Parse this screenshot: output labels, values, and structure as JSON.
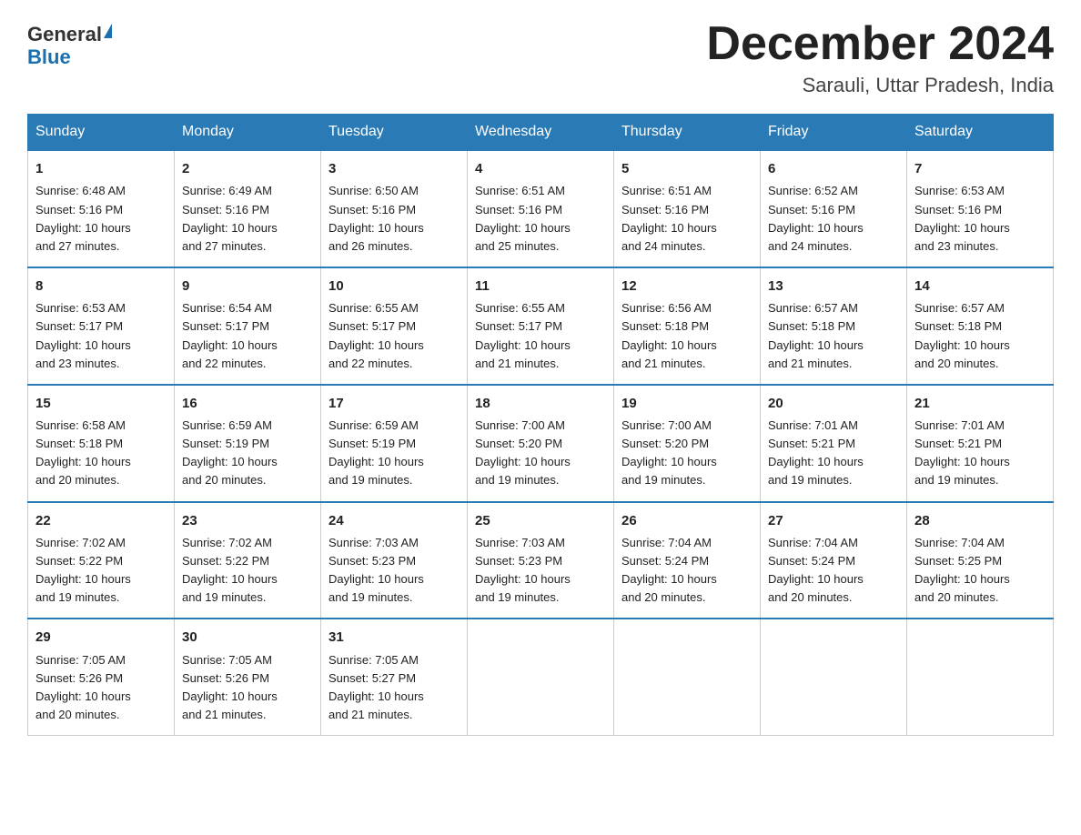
{
  "header": {
    "logo_general": "General",
    "logo_blue": "Blue",
    "month_title": "December 2024",
    "location": "Sarauli, Uttar Pradesh, India"
  },
  "days_of_week": [
    "Sunday",
    "Monday",
    "Tuesday",
    "Wednesday",
    "Thursday",
    "Friday",
    "Saturday"
  ],
  "weeks": [
    [
      {
        "day": "1",
        "sunrise": "6:48 AM",
        "sunset": "5:16 PM",
        "daylight": "10 hours and 27 minutes."
      },
      {
        "day": "2",
        "sunrise": "6:49 AM",
        "sunset": "5:16 PM",
        "daylight": "10 hours and 27 minutes."
      },
      {
        "day": "3",
        "sunrise": "6:50 AM",
        "sunset": "5:16 PM",
        "daylight": "10 hours and 26 minutes."
      },
      {
        "day": "4",
        "sunrise": "6:51 AM",
        "sunset": "5:16 PM",
        "daylight": "10 hours and 25 minutes."
      },
      {
        "day": "5",
        "sunrise": "6:51 AM",
        "sunset": "5:16 PM",
        "daylight": "10 hours and 24 minutes."
      },
      {
        "day": "6",
        "sunrise": "6:52 AM",
        "sunset": "5:16 PM",
        "daylight": "10 hours and 24 minutes."
      },
      {
        "day": "7",
        "sunrise": "6:53 AM",
        "sunset": "5:16 PM",
        "daylight": "10 hours and 23 minutes."
      }
    ],
    [
      {
        "day": "8",
        "sunrise": "6:53 AM",
        "sunset": "5:17 PM",
        "daylight": "10 hours and 23 minutes."
      },
      {
        "day": "9",
        "sunrise": "6:54 AM",
        "sunset": "5:17 PM",
        "daylight": "10 hours and 22 minutes."
      },
      {
        "day": "10",
        "sunrise": "6:55 AM",
        "sunset": "5:17 PM",
        "daylight": "10 hours and 22 minutes."
      },
      {
        "day": "11",
        "sunrise": "6:55 AM",
        "sunset": "5:17 PM",
        "daylight": "10 hours and 21 minutes."
      },
      {
        "day": "12",
        "sunrise": "6:56 AM",
        "sunset": "5:18 PM",
        "daylight": "10 hours and 21 minutes."
      },
      {
        "day": "13",
        "sunrise": "6:57 AM",
        "sunset": "5:18 PM",
        "daylight": "10 hours and 21 minutes."
      },
      {
        "day": "14",
        "sunrise": "6:57 AM",
        "sunset": "5:18 PM",
        "daylight": "10 hours and 20 minutes."
      }
    ],
    [
      {
        "day": "15",
        "sunrise": "6:58 AM",
        "sunset": "5:18 PM",
        "daylight": "10 hours and 20 minutes."
      },
      {
        "day": "16",
        "sunrise": "6:59 AM",
        "sunset": "5:19 PM",
        "daylight": "10 hours and 20 minutes."
      },
      {
        "day": "17",
        "sunrise": "6:59 AM",
        "sunset": "5:19 PM",
        "daylight": "10 hours and 19 minutes."
      },
      {
        "day": "18",
        "sunrise": "7:00 AM",
        "sunset": "5:20 PM",
        "daylight": "10 hours and 19 minutes."
      },
      {
        "day": "19",
        "sunrise": "7:00 AM",
        "sunset": "5:20 PM",
        "daylight": "10 hours and 19 minutes."
      },
      {
        "day": "20",
        "sunrise": "7:01 AM",
        "sunset": "5:21 PM",
        "daylight": "10 hours and 19 minutes."
      },
      {
        "day": "21",
        "sunrise": "7:01 AM",
        "sunset": "5:21 PM",
        "daylight": "10 hours and 19 minutes."
      }
    ],
    [
      {
        "day": "22",
        "sunrise": "7:02 AM",
        "sunset": "5:22 PM",
        "daylight": "10 hours and 19 minutes."
      },
      {
        "day": "23",
        "sunrise": "7:02 AM",
        "sunset": "5:22 PM",
        "daylight": "10 hours and 19 minutes."
      },
      {
        "day": "24",
        "sunrise": "7:03 AM",
        "sunset": "5:23 PM",
        "daylight": "10 hours and 19 minutes."
      },
      {
        "day": "25",
        "sunrise": "7:03 AM",
        "sunset": "5:23 PM",
        "daylight": "10 hours and 19 minutes."
      },
      {
        "day": "26",
        "sunrise": "7:04 AM",
        "sunset": "5:24 PM",
        "daylight": "10 hours and 20 minutes."
      },
      {
        "day": "27",
        "sunrise": "7:04 AM",
        "sunset": "5:24 PM",
        "daylight": "10 hours and 20 minutes."
      },
      {
        "day": "28",
        "sunrise": "7:04 AM",
        "sunset": "5:25 PM",
        "daylight": "10 hours and 20 minutes."
      }
    ],
    [
      {
        "day": "29",
        "sunrise": "7:05 AM",
        "sunset": "5:26 PM",
        "daylight": "10 hours and 20 minutes."
      },
      {
        "day": "30",
        "sunrise": "7:05 AM",
        "sunset": "5:26 PM",
        "daylight": "10 hours and 21 minutes."
      },
      {
        "day": "31",
        "sunrise": "7:05 AM",
        "sunset": "5:27 PM",
        "daylight": "10 hours and 21 minutes."
      },
      null,
      null,
      null,
      null
    ]
  ],
  "labels": {
    "sunrise": "Sunrise:",
    "sunset": "Sunset:",
    "daylight": "Daylight:"
  }
}
